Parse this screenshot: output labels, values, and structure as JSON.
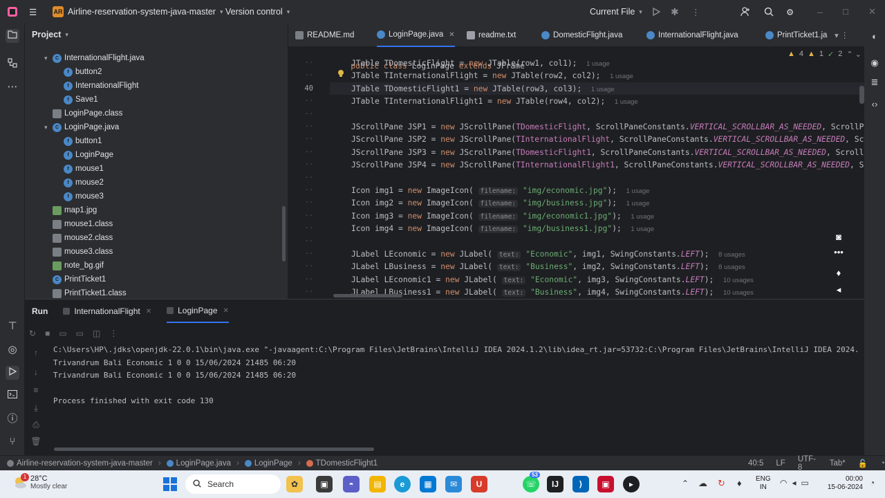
{
  "titlebar": {
    "project_badge": "AR",
    "project_name": "Airline-reservation-system-java-master",
    "vcs": "Version control",
    "run_config": "Current File"
  },
  "project_panel": {
    "title": "Project",
    "items": [
      {
        "label": "InternationalFlight.java",
        "kind": "class",
        "expanded": true
      },
      {
        "label": "button2",
        "kind": "member"
      },
      {
        "label": "InternationalFlight",
        "kind": "member"
      },
      {
        "label": "Save1",
        "kind": "member"
      },
      {
        "label": "LoginPage.class",
        "kind": "file"
      },
      {
        "label": "LoginPage.java",
        "kind": "class",
        "expanded": true
      },
      {
        "label": "button1",
        "kind": "member"
      },
      {
        "label": "LoginPage",
        "kind": "member"
      },
      {
        "label": "mouse1",
        "kind": "member"
      },
      {
        "label": "mouse2",
        "kind": "member"
      },
      {
        "label": "mouse3",
        "kind": "member"
      },
      {
        "label": "map1.jpg",
        "kind": "img"
      },
      {
        "label": "mouse1.class",
        "kind": "file"
      },
      {
        "label": "mouse2.class",
        "kind": "file"
      },
      {
        "label": "mouse3.class",
        "kind": "file"
      },
      {
        "label": "note_bg.gif",
        "kind": "img"
      },
      {
        "label": "PrintTicket1",
        "kind": "class"
      },
      {
        "label": "PrintTicket1.class",
        "kind": "file"
      }
    ]
  },
  "editor": {
    "tabs": [
      {
        "label": "README.md",
        "kind": "md"
      },
      {
        "label": "LoginPage.java",
        "kind": "java",
        "active": true
      },
      {
        "label": "readme.txt",
        "kind": "txt"
      },
      {
        "label": "DomesticFlight.java",
        "kind": "java"
      },
      {
        "label": "InternationalFlight.java",
        "kind": "java"
      },
      {
        "label": "PrintTicket1.ja",
        "kind": "java"
      }
    ],
    "sticky_header": "public class LoginPage extends JFrame",
    "inspections": {
      "warnings": "4",
      "weak": "1",
      "typos": "2"
    },
    "current_line_number": "40",
    "usage_1": "1 usage",
    "usage_8": "8 usages",
    "usage_10": "10 usages",
    "hint_filename": "filename:",
    "hint_text": "text:"
  },
  "run_panel": {
    "label": "Run",
    "tabs": [
      "InternationalFlight",
      "LoginPage"
    ],
    "console": [
      "C:\\Users\\HP\\.jdks\\openjdk-22.0.1\\bin\\java.exe \"-javaagent:C:\\Program Files\\JetBrains\\IntelliJ IDEA 2024.1.2\\lib\\idea_rt.jar=53732:C:\\Program Files\\JetBrains\\IntelliJ IDEA 2024.",
      "Trivandrum Bali Economic 1 0 0 15/06/2024 21485 06:20",
      "Trivandrum Bali Economic 1 0 0 15/06/2024 21485 06:20",
      "",
      "Process finished with exit code 130"
    ]
  },
  "statusbar": {
    "crumbs": [
      "Airline-reservation-system-java-master",
      "LoginPage.java",
      "LoginPage",
      "TDomesticFlight1"
    ],
    "position": "40:5",
    "line_sep": "LF",
    "encoding": "UTF-8",
    "indent": "Tab*"
  },
  "taskbar": {
    "temp": "28°C",
    "weather": "Mostly clear",
    "weather_badge": "1",
    "search": "Search",
    "lang_top": "ENG",
    "lang_bottom": "IN",
    "time": "00:00",
    "date": "15-06-2024",
    "teams_badge": "53"
  },
  "colors": {
    "accent": "#3574f0",
    "keyword": "#cf8e6d",
    "string": "#6aab73",
    "static_field": "#c77dbb"
  }
}
